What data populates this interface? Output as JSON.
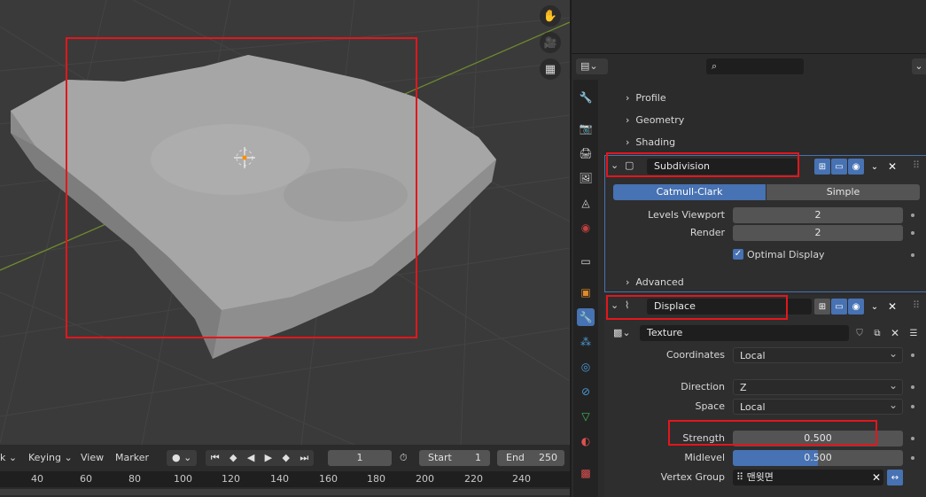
{
  "viewport": {
    "icons": [
      "hand-icon",
      "camera-icon",
      "grid-icon"
    ]
  },
  "timeline": {
    "menu_partial": "k",
    "keying": "Keying",
    "view": "View",
    "marker": "Marker",
    "current_frame": "1",
    "start_label": "Start",
    "start_value": "1",
    "end_label": "End",
    "end_value": "250",
    "ruler": [
      "40",
      "60",
      "80",
      "100",
      "120",
      "140",
      "160",
      "180",
      "200",
      "220",
      "240"
    ]
  },
  "properties": {
    "sections": {
      "profile": "Profile",
      "geometry": "Geometry",
      "shading": "Shading"
    },
    "subdivision": {
      "name": "Subdivision",
      "tab_catmull": "Catmull-Clark",
      "tab_simple": "Simple",
      "levels_viewport_label": "Levels Viewport",
      "levels_viewport_value": "2",
      "render_label": "Render",
      "render_value": "2",
      "optimal_display": "Optimal Display",
      "advanced": "Advanced"
    },
    "displace": {
      "name": "Displace",
      "texture": "Texture",
      "coordinates_label": "Coordinates",
      "coordinates_value": "Local",
      "direction_label": "Direction",
      "direction_value": "Z",
      "space_label": "Space",
      "space_value": "Local",
      "strength_label": "Strength",
      "strength_value": "0.500",
      "midlevel_label": "Midlevel",
      "midlevel_value": "0.500",
      "midlevel_fraction": 0.5,
      "vertex_group_label": "Vertex Group",
      "vertex_group_value": "맨윗면"
    }
  },
  "colors": {
    "accent": "#4772b3",
    "highlight": "#e3161c"
  }
}
